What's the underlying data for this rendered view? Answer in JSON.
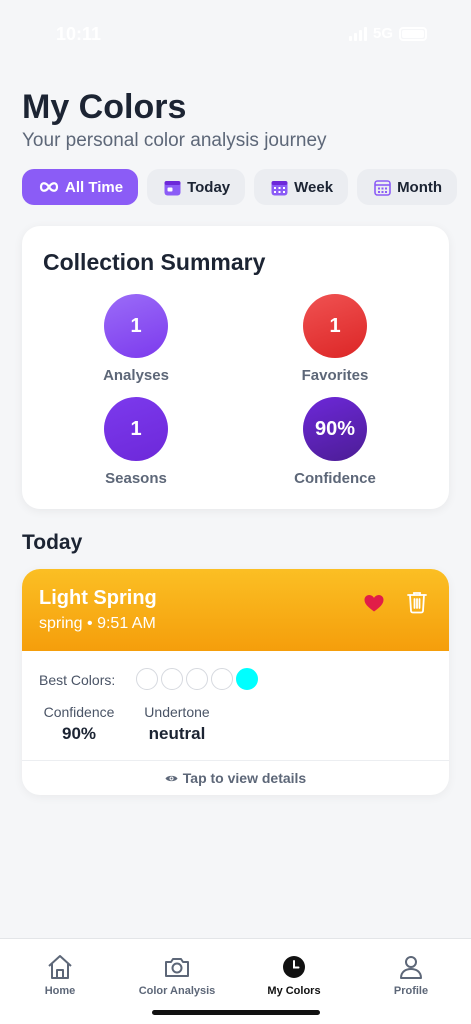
{
  "status_bar": {
    "time": "10:11",
    "network": "5G"
  },
  "header": {
    "title": "My Colors",
    "subtitle": "Your personal color analysis journey"
  },
  "filters": [
    {
      "label": "All Time",
      "icon": "infinity-icon",
      "active": true
    },
    {
      "label": "Today",
      "icon": "calendar-icon",
      "active": false
    },
    {
      "label": "Week",
      "icon": "calendar-week-icon",
      "active": false
    },
    {
      "label": "Month",
      "icon": "calendar-month-icon",
      "active": false
    }
  ],
  "summary": {
    "title": "Collection Summary",
    "stats": [
      {
        "value": "1",
        "label": "Analyses",
        "color": "#8b5cf6"
      },
      {
        "value": "1",
        "label": "Favorites",
        "color": "#ef4444"
      },
      {
        "value": "1",
        "label": "Seasons",
        "color": "#7c3aed"
      },
      {
        "value": "90%",
        "label": "Confidence",
        "color": "#5b21b6"
      }
    ]
  },
  "section": {
    "title": "Today"
  },
  "analysis": {
    "name": "Light Spring",
    "season": "spring",
    "time": "9:51 AM",
    "header_color": "#f7b21a",
    "best_colors_label": "Best Colors:",
    "best_colors": [
      "#ffffff",
      "#ffffff",
      "#ffffff",
      "#ffffff",
      "#00ffff"
    ],
    "confidence_label": "Confidence",
    "confidence": "90%",
    "undertone_label": "Undertone",
    "undertone": "neutral",
    "details_label": "Tap to view details",
    "favorite": true
  },
  "tabs": [
    {
      "label": "Home",
      "icon": "home-icon",
      "active": false
    },
    {
      "label": "Color Analysis",
      "icon": "camera-icon",
      "active": false
    },
    {
      "label": "My Colors",
      "icon": "clock-icon",
      "active": true
    },
    {
      "label": "Profile",
      "icon": "profile-icon",
      "active": false
    }
  ],
  "colors": {
    "accent": "#8b5cf6",
    "favorite": "#e11d48",
    "background": "#f5f6f8"
  }
}
